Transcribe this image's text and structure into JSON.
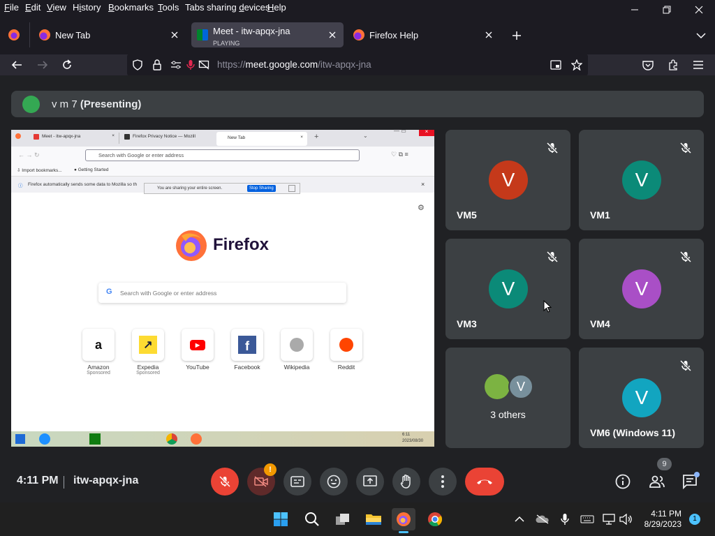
{
  "menu": [
    "File",
    "Edit",
    "View",
    "History",
    "Bookmarks",
    "Tools",
    "Tabs sharing devices",
    "Help"
  ],
  "menu_ul": [
    "F",
    "E",
    "V",
    "i",
    "B",
    "T",
    "d",
    "H"
  ],
  "tabs": [
    {
      "title": "New Tab"
    },
    {
      "title": "Meet - itw-apqx-jna",
      "sub": "PLAYING"
    },
    {
      "title": "Firefox Help"
    }
  ],
  "url": {
    "prefix": "https://",
    "host": "meet.google.com",
    "path": "/itw-apqx-jna"
  },
  "meet": {
    "presenter_initial_name": "v m 7",
    "presenting_label": "(Presenting)",
    "participants": [
      {
        "name": "VM5",
        "initial": "V",
        "color": "#c5391a"
      },
      {
        "name": "VM1",
        "initial": "V",
        "color": "#0b8a78"
      },
      {
        "name": "VM3",
        "initial": "V",
        "color": "#0b8a78"
      },
      {
        "name": "VM4",
        "initial": "V",
        "color": "#a94fc6"
      },
      {
        "name": "3 others",
        "initial": "V",
        "color": "#78909c"
      },
      {
        "name": "VM6 (Windows 11)",
        "initial": "V",
        "color": "#12a5c0"
      }
    ],
    "time": "4:11 PM",
    "code": "itw-apqx-jna",
    "people_count": "9"
  },
  "shared": {
    "tabs": [
      "Meet - itw-apqx-jna",
      "Firefox Privacy Notice — Mozill",
      "New Tab"
    ],
    "search_placeholder": "Search with Google or enter address",
    "bookmarks": [
      "Import bookmarks...",
      "Getting Started"
    ],
    "notice": "Firefox automatically sends some data to Mozilla so th",
    "sharing_text": "You are sharing your entire screen.",
    "stop_label": "Stop Sharing",
    "brand": "Firefox",
    "shortcuts": [
      {
        "name": "Amazon",
        "sponsored": "Sponsored"
      },
      {
        "name": "Expedia",
        "sponsored": "Sponsored"
      },
      {
        "name": "YouTube",
        "sponsored": ""
      },
      {
        "name": "Facebook",
        "sponsored": ""
      },
      {
        "name": "Wikipedia",
        "sponsored": ""
      },
      {
        "name": "Reddit",
        "sponsored": ""
      }
    ],
    "taskbar_date": "2023/08/30",
    "taskbar_time": "6:11"
  },
  "taskbar": {
    "time": "4:11 PM",
    "date": "8/29/2023",
    "notif": "1"
  }
}
